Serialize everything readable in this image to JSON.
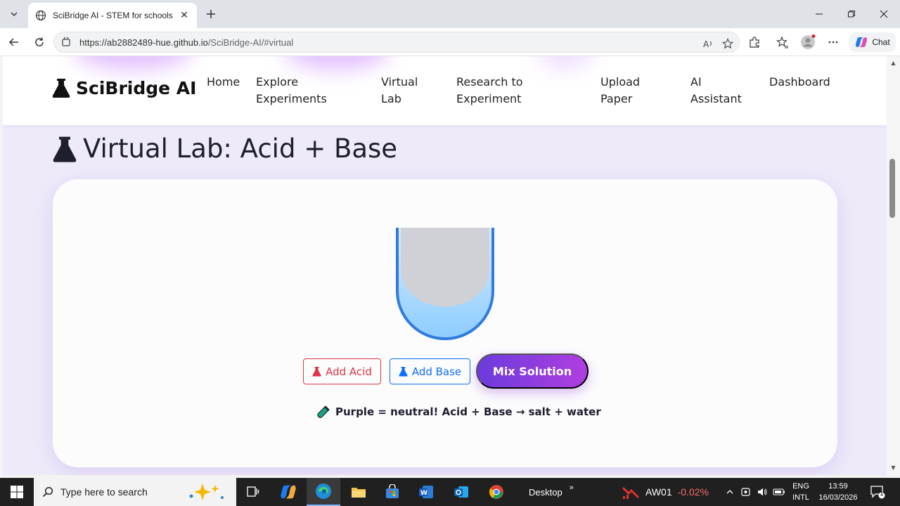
{
  "browser": {
    "tab_title": "SciBridge AI - STEM for schools",
    "url_host": "https://ab2882489-hue.github.io",
    "url_path": "/SciBridge-AI/#virtual",
    "chat_label": "Chat"
  },
  "site": {
    "brand": "SciBridge AI",
    "nav": [
      "Home",
      "Explore Experiments",
      "Virtual Lab",
      "Research to Experiment",
      "Upload Paper",
      "AI Assistant",
      "Dashboard"
    ]
  },
  "lab": {
    "title": "Virtual Lab: Acid + Base",
    "add_acid_label": "Add Acid",
    "add_base_label": "Add Base",
    "mix_label": "Mix Solution",
    "result_text": "Purple = neutral! Acid + Base → salt + water",
    "beaker_liquid_color": "#bfe3ff",
    "beaker_outline_color": "#2f7be0"
  },
  "colors": {
    "accent": "#7b3fe4",
    "acid": "#dc3545",
    "base": "#0d6efd"
  },
  "taskbar": {
    "search_placeholder": "Type here to search",
    "desktop_label": "Desktop",
    "stock_symbol": "AW01",
    "stock_change": "-0.02%",
    "lang_line1": "ENG",
    "lang_line2": "INTL",
    "time": "13:59",
    "date": "16/03/2026",
    "notification_count": "1"
  }
}
